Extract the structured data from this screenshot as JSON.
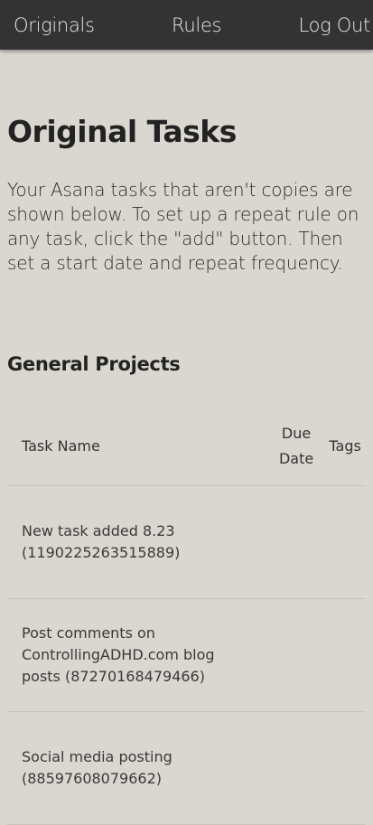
{
  "nav": {
    "originals": "Originals",
    "rules": "Rules",
    "logout": "Log Out"
  },
  "page": {
    "title": "Original Tasks",
    "intro": "Your Asana tasks that aren't copies are shown below. To set up a repeat rule on any task, click the \"add\" button. Then set a start date and repeat frequency."
  },
  "section": {
    "title": "General Projects"
  },
  "table": {
    "headers": {
      "task_name": "Task Name",
      "due_date": "Due Date",
      "tags": "Tags"
    },
    "rows": [
      {
        "name": "New task added 8.23 (1190225263515889)",
        "due": "",
        "tags": ""
      },
      {
        "name": "Post comments on ControllingADHD.com blog posts (87270168479466)",
        "due": "",
        "tags": ""
      },
      {
        "name": "Social media posting (88597608079662)",
        "due": "",
        "tags": ""
      }
    ]
  }
}
